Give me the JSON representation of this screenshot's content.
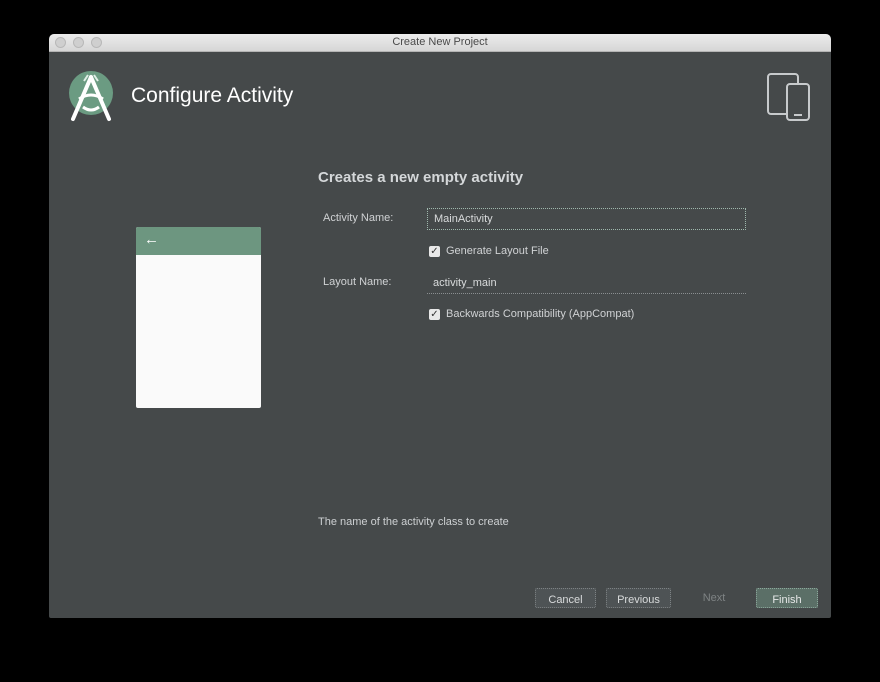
{
  "window": {
    "title": "Create New Project"
  },
  "header": {
    "title": "Configure Activity",
    "logo_icon": "android-studio-logo",
    "device_icon": "devices-icon"
  },
  "form": {
    "subtitle": "Creates a new empty activity",
    "activity_name_label": "Activity Name:",
    "activity_name_value": "MainActivity",
    "generate_layout_label": "Generate Layout File",
    "generate_layout_checked": true,
    "layout_name_label": "Layout Name:",
    "layout_name_value": "activity_main",
    "backwards_compat_label": "Backwards Compatibility (AppCompat)",
    "backwards_compat_checked": true
  },
  "preview": {
    "back_icon": "arrow-left-icon",
    "back_glyph": "←"
  },
  "hint": "The name of the activity class to create",
  "buttons": {
    "cancel": "Cancel",
    "previous": "Previous",
    "next": "Next",
    "finish": "Finish"
  },
  "colors": {
    "background": "#45494a",
    "accent": "#6d9680"
  }
}
